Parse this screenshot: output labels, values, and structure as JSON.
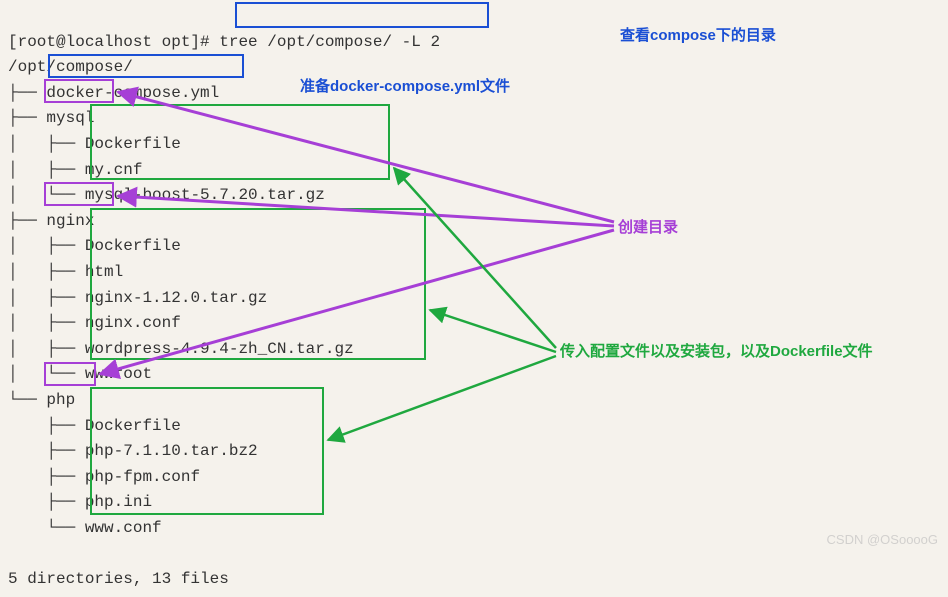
{
  "terminal": {
    "prompt": "[root@localhost opt]#",
    "command": "tree /opt/compose/ -L 2",
    "root_path": "/opt/compose/",
    "tree": {
      "compose_yml": "docker-compose.yml",
      "mysql": {
        "name": "mysql",
        "files": [
          "Dockerfile",
          "my.cnf",
          "mysql-boost-5.7.20.tar.gz"
        ]
      },
      "nginx": {
        "name": "nginx",
        "files": [
          "Dockerfile",
          "html",
          "nginx-1.12.0.tar.gz",
          "nginx.conf",
          "wordpress-4.9.4-zh_CN.tar.gz",
          "wwwroot"
        ]
      },
      "php": {
        "name": "php",
        "files": [
          "Dockerfile",
          "php-7.1.10.tar.bz2",
          "php-fpm.conf",
          "php.ini",
          "www.conf"
        ]
      }
    },
    "summary": "5 directories, 13 files"
  },
  "annotations": {
    "view_dir": "查看compose下的目录",
    "prepare_yml": "准备docker-compose.yml文件",
    "create_dir": "创建目录",
    "transfer_files": "传入配置文件以及安装包，以及Dockerfile文件"
  },
  "watermark": "CSDN @OSooooG"
}
